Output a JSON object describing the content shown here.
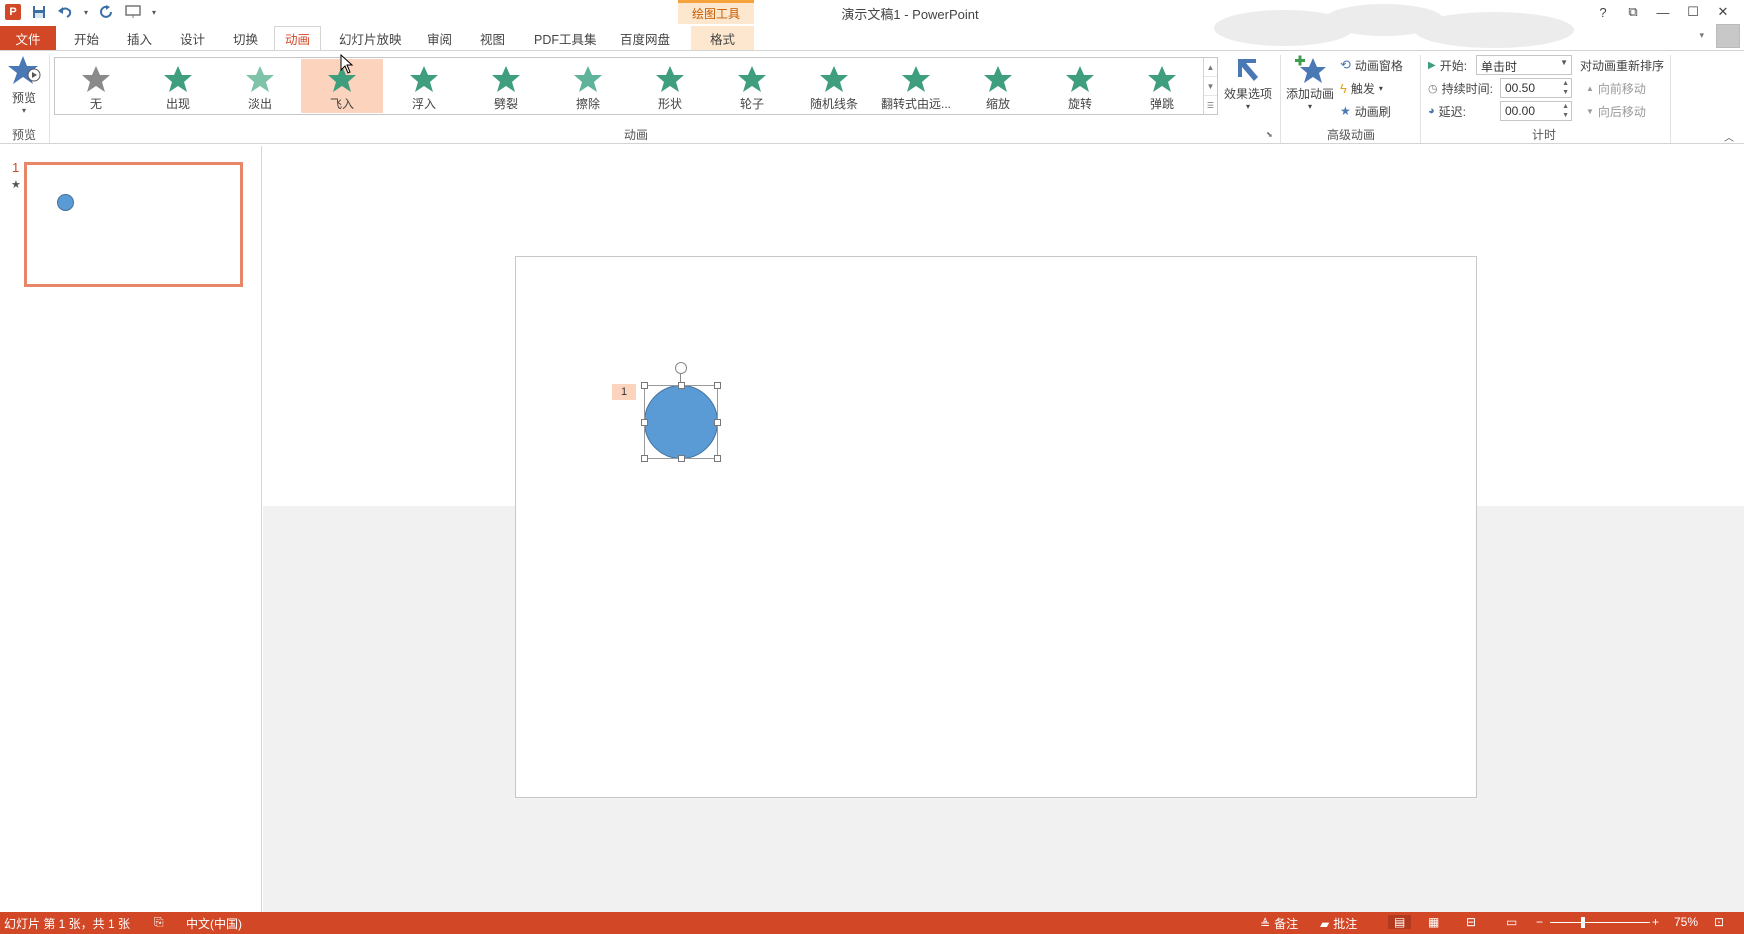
{
  "title_bar": {
    "context_tab_header": "绘图工具",
    "document_title": "演示文稿1 - PowerPoint",
    "help": "?",
    "window_controls": [
      "?",
      "⧉",
      "—",
      "☐",
      "✕"
    ]
  },
  "tabs": [
    {
      "label": "文件"
    },
    {
      "label": "开始"
    },
    {
      "label": "插入"
    },
    {
      "label": "设计"
    },
    {
      "label": "切换"
    },
    {
      "label": "动画"
    },
    {
      "label": "幻灯片放映"
    },
    {
      "label": "审阅"
    },
    {
      "label": "视图"
    },
    {
      "label": "PDF工具集"
    },
    {
      "label": "百度网盘"
    },
    {
      "label": "格式"
    }
  ],
  "active_tab": "动画",
  "ribbon": {
    "preview": {
      "label": "预览",
      "group_label": "预览"
    },
    "animation_group_label": "动画",
    "animations": [
      {
        "label": "无",
        "color": "#8a8a8a"
      },
      {
        "label": "出现",
        "color": "#3e9e7e"
      },
      {
        "label": "淡出",
        "color": "#7fc3a9"
      },
      {
        "label": "飞入",
        "color": "#3e9e7e"
      },
      {
        "label": "浮入",
        "color": "#3e9e7e"
      },
      {
        "label": "劈裂",
        "color": "#3e9e7e"
      },
      {
        "label": "擦除",
        "color": "#5fb39a"
      },
      {
        "label": "形状",
        "color": "#3e9e7e"
      },
      {
        "label": "轮子",
        "color": "#3e9e7e"
      },
      {
        "label": "随机线条",
        "color": "#3e9e7e"
      },
      {
        "label": "翻转式由远...",
        "color": "#3e9e7e"
      },
      {
        "label": "缩放",
        "color": "#3e9e7e"
      },
      {
        "label": "旋转",
        "color": "#3e9e7e"
      },
      {
        "label": "弹跳",
        "color": "#3e9e7e"
      }
    ],
    "selected_animation": "飞入",
    "effect_options": "效果选项",
    "advanced": {
      "group_label": "高级动画",
      "add_animation": "添加动画",
      "animation_pane": "动画窗格",
      "trigger": "触发",
      "animation_painter": "动画刷"
    },
    "timing": {
      "group_label": "计时",
      "start_label": "开始:",
      "start_value": "单击时",
      "duration_label": "持续时间:",
      "duration_value": "00.50",
      "delay_label": "延迟:",
      "delay_value": "00.00",
      "reorder_title": "对动画重新排序",
      "move_earlier": "向前移动",
      "move_later": "向后移动"
    }
  },
  "thumbnails": {
    "slide_number": "1",
    "anim_marker": "★"
  },
  "slide": {
    "anim_tag": "1",
    "shape_color": "#5b9bd5"
  },
  "status_bar": {
    "slide_info": "幻灯片 第 1 张，共 1 张",
    "language": "中文(中国)",
    "notes": "备注",
    "comments": "批注",
    "zoom_minus": "−",
    "zoom_plus": "+",
    "zoom": "75%"
  },
  "colors": {
    "accent": "#d24726",
    "selection": "#fcd3bd",
    "context_tab": "#fde8cf"
  }
}
